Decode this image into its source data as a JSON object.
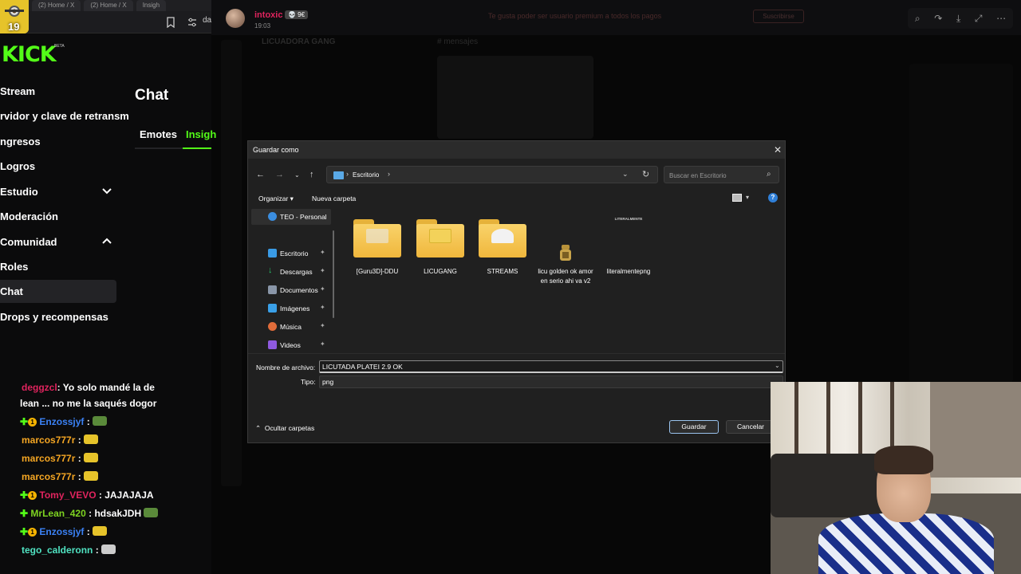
{
  "browser": {
    "tabs": [
      "(2) Home / X",
      "(2) Home / X",
      "Insigh"
    ],
    "address": "da",
    "avatar_badge": "19"
  },
  "kick": {
    "logo": "KICK",
    "logo_badge": "BETA",
    "nav": [
      {
        "label": "Stream"
      },
      {
        "label": "rvidor y clave de retransm"
      },
      {
        "label": "ngresos"
      },
      {
        "label": "Logros"
      },
      {
        "label": "Estudio"
      },
      {
        "label": "Moderación"
      },
      {
        "label": "Comunidad"
      },
      {
        "label": "Roles"
      },
      {
        "label": "Chat"
      },
      {
        "label": "Drops y recompensas"
      }
    ],
    "chat_title": "Chat",
    "chat_tabs": [
      "Emotes",
      "Insigh"
    ],
    "messages": [
      {
        "user": "deggzcl",
        "text": ": Yo solo mandé la de",
        "user_color": "#e0245e"
      },
      {
        "user": "",
        "text": "lean ... no me la saqués dogor",
        "user_color": "#e0245e"
      },
      {
        "user": "Enzossjyf",
        "text": " :",
        "user_color": "#3b82f6"
      },
      {
        "user": "marcos777r",
        "text": " :",
        "user_color": "#f5a623"
      },
      {
        "user": "marcos777r",
        "text": " :",
        "user_color": "#f5a623"
      },
      {
        "user": "marcos777r",
        "text": " :",
        "user_color": "#f5a623"
      },
      {
        "user": "Tomy_VEVO",
        "text": " : JAJAJAJA",
        "user_color": "#e0245e"
      },
      {
        "user": "MrLean_420",
        "text": " : hdsakJDH",
        "user_color": "#7ed321"
      },
      {
        "user": "Enzossjyf",
        "text": " :",
        "user_color": "#3b82f6"
      },
      {
        "user": "tego_calderonn",
        "text": " :",
        "user_color": "#50e3c2"
      }
    ]
  },
  "discord": {
    "username": "intoxic",
    "badge": "💀 9€",
    "time": "19:03",
    "banner": "Te gusta poder ser usuario premium a todos los pagos",
    "banner_button": "Suscribirse",
    "tools": [
      "⌕",
      "↷",
      "⤓",
      "⤢",
      "⋯"
    ],
    "ghost_server": "LICUADORA GANG",
    "ghost_channel": "# mensajes"
  },
  "dialog": {
    "title": "Guardar como",
    "close": "✕",
    "path": "Escritorio",
    "search_placeholder": "Buscar en Escritorio",
    "organize": "Organizar ▾",
    "new_folder": "Nueva carpeta",
    "sidebar": [
      {
        "label": "TEO - Personal",
        "icon": "cloud-icon",
        "color": "#3b8ee0"
      },
      {
        "label": "Escritorio",
        "icon": "desktop-icon",
        "color": "#3a9be6"
      },
      {
        "label": "Descargas",
        "icon": "download-icon",
        "color": "#29c36b"
      },
      {
        "label": "Documentos",
        "icon": "documents-icon",
        "color": "#8a96a8"
      },
      {
        "label": "Imágenes",
        "icon": "pictures-icon",
        "color": "#3aa0e8"
      },
      {
        "label": "Música",
        "icon": "music-icon",
        "color": "#e06c3a"
      },
      {
        "label": "Videos",
        "icon": "videos-icon",
        "color": "#8f5ae0"
      }
    ],
    "files": [
      {
        "name": "[Guru3D]-DDU",
        "type": "folder"
      },
      {
        "name": "LICUGANG",
        "type": "folder"
      },
      {
        "name": "STREAMS",
        "type": "folder"
      },
      {
        "name": "licu golden ok amor en serio ahi va v2",
        "type": "image"
      },
      {
        "name": "literalmentepng",
        "type": "image"
      }
    ],
    "literalmente_thumb": "LITERALMENTE",
    "filename_label": "Nombre de archivo:",
    "filename_value": "LICUTADA PLATEI 2.9 OK",
    "type_label": "Tipo:",
    "type_value": "png",
    "hide_folders": "Ocultar carpetas",
    "save": "Guardar",
    "cancel": "Cancelar"
  }
}
